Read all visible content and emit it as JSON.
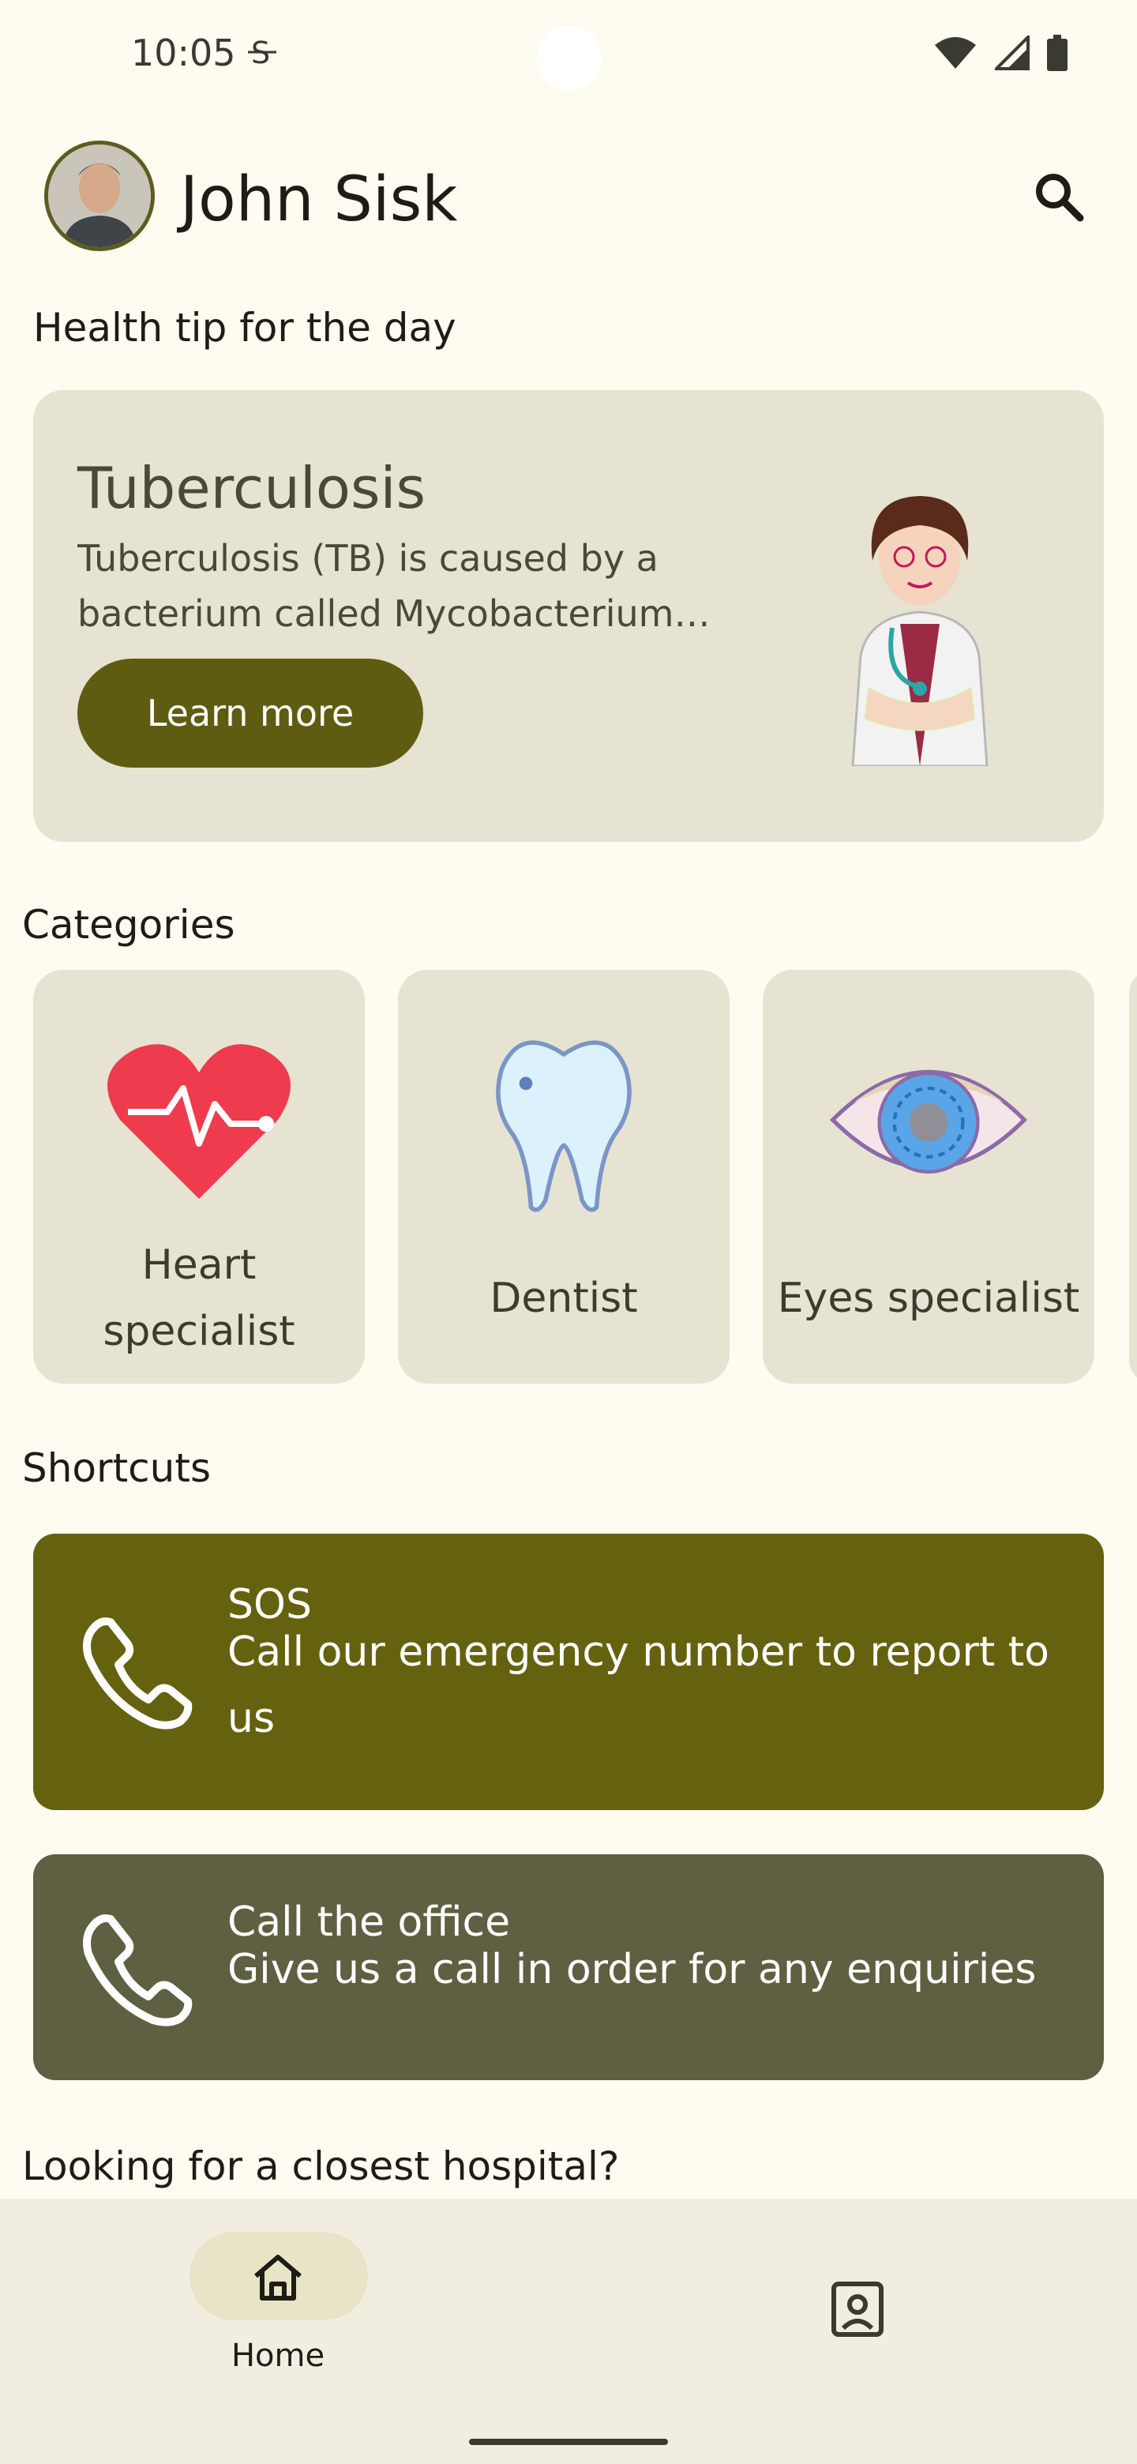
{
  "status_bar": {
    "time": "10:05",
    "sync_icon": "sync-s-icon",
    "wifi_icon": "wifi-icon",
    "signal_icon": "signal-icon",
    "battery_icon": "battery-icon"
  },
  "header": {
    "user_name": "John Sisk",
    "avatar_icon": "user-avatar",
    "search_icon": "search-icon"
  },
  "health_tip": {
    "section_title": "Health tip for the day",
    "title": "Tuberculosis",
    "description": "Tuberculosis (TB) is caused by a bacterium called Mycobacterium tuberculosis",
    "button_label": "Learn more",
    "illustration": "doctor-illustration"
  },
  "categories": {
    "section_title": "Categories",
    "items": [
      {
        "label": "Heart specialist",
        "icon": "heart-icon"
      },
      {
        "label": "Dentist",
        "icon": "tooth-icon"
      },
      {
        "label": "Eyes specialist",
        "icon": "eye-icon"
      }
    ]
  },
  "shortcuts": {
    "section_title": "Shortcuts",
    "items": [
      {
        "title": "SOS",
        "description": "Call our emergency number to report to us",
        "icon": "phone-icon",
        "color": "#64620E"
      },
      {
        "title": "Call the office",
        "description": "Give us a call in order for any enquiries",
        "icon": "phone-icon",
        "color": "#5F5F41"
      }
    ]
  },
  "hospital_section": {
    "title": "Looking for a closest hospital?"
  },
  "bottom_nav": {
    "items": [
      {
        "label": "Home",
        "icon": "home-icon",
        "selected": true
      },
      {
        "label": "",
        "icon": "contact-icon",
        "selected": false
      }
    ]
  },
  "colors": {
    "background": "#FEFBF1",
    "card": "#E6E3D2",
    "primary": "#5E5C10",
    "secondary": "#5F5F41"
  }
}
